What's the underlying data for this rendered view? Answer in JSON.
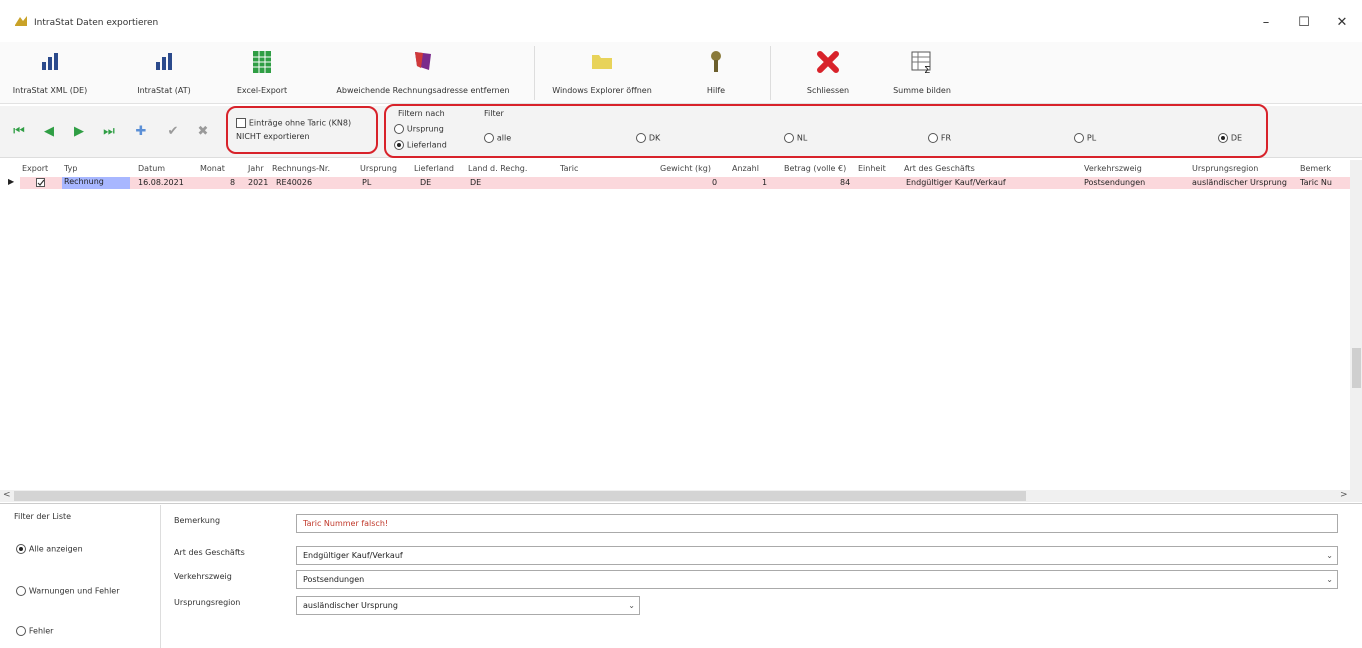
{
  "window": {
    "title": "IntraStat Daten exportieren",
    "minimize": "–",
    "maximize": "☐",
    "close": "✕"
  },
  "toolbar": {
    "xml_de": "IntraStat XML (DE)",
    "at": "IntraStat (AT)",
    "excel": "Excel-Export",
    "remove_addr": "Abweichende Rechnungsadresse entfernen",
    "explorer": "Windows Explorer öffnen",
    "help": "Hilfe",
    "close": "Schliessen",
    "sum": "Summe bilden"
  },
  "nav": {
    "first": "⏮",
    "prev": "◀",
    "next": "▶",
    "last": "⏭",
    "add": "✚",
    "confirm": "✔",
    "cancel": "✖",
    "no_taric_line1": "Einträge ohne Taric (KN8)",
    "no_taric_line2": "NICHT exportieren",
    "filter_by_title": "Filtern nach",
    "filter_by_origin": "Ursprung",
    "filter_by_supplier": "Lieferland",
    "filter_title": "Filter",
    "filter_options": [
      "alle",
      "DK",
      "NL",
      "FR",
      "PL",
      "DE"
    ],
    "filter_selected": "DE"
  },
  "grid": {
    "headers": [
      "Export",
      "Typ",
      "Datum",
      "Monat",
      "Jahr",
      "Rechnungs-Nr.",
      "Ursprung",
      "Lieferland",
      "Land d. Rechg.",
      "Taric",
      "Gewicht (kg)",
      "Anzahl",
      "Betrag (volle €)",
      "Einheit",
      "Art des Geschäfts",
      "Verkehrszweig",
      "Ursprungsregion",
      "Bemerk"
    ],
    "rows": [
      {
        "export": true,
        "typ": "Rechnung",
        "datum": "16.08.2021",
        "monat": "8",
        "jahr": "2021",
        "nr": "RE40026",
        "ursprung": "PL",
        "lieferland": "DE",
        "land_rechg": "DE",
        "taric": "",
        "gewicht": "0",
        "anzahl": "1",
        "betrag": "84",
        "einheit": "",
        "art": "Endgültiger Kauf/Verkauf",
        "verkehr": "Postsendungen",
        "region": "ausländischer Ursprung",
        "bemerk": "Taric Nu"
      }
    ],
    "row_marker": "▶",
    "hscroll_left": "<",
    "hscroll_right": ">"
  },
  "bottom": {
    "filter_list_title": "Filter der Liste",
    "show_all": "Alle anzeigen",
    "warnings_errors": "Warnungen und Fehler",
    "errors": "Fehler",
    "remark_label": "Bemerkung",
    "remark_value": "Taric Nummer falsch!",
    "art_label": "Art des Geschäfts",
    "art_value": "Endgültiger Kauf/Verkauf",
    "verkehr_label": "Verkehrszweig",
    "verkehr_value": "Postsendungen",
    "region_label": "Ursprungsregion",
    "region_value": "ausländischer Ursprung"
  },
  "colors": {
    "highlight_red": "#d8222a",
    "row_pink": "#fbd8dc",
    "type_cell": "#a8b7ff",
    "remark_text": "#c0392b"
  }
}
